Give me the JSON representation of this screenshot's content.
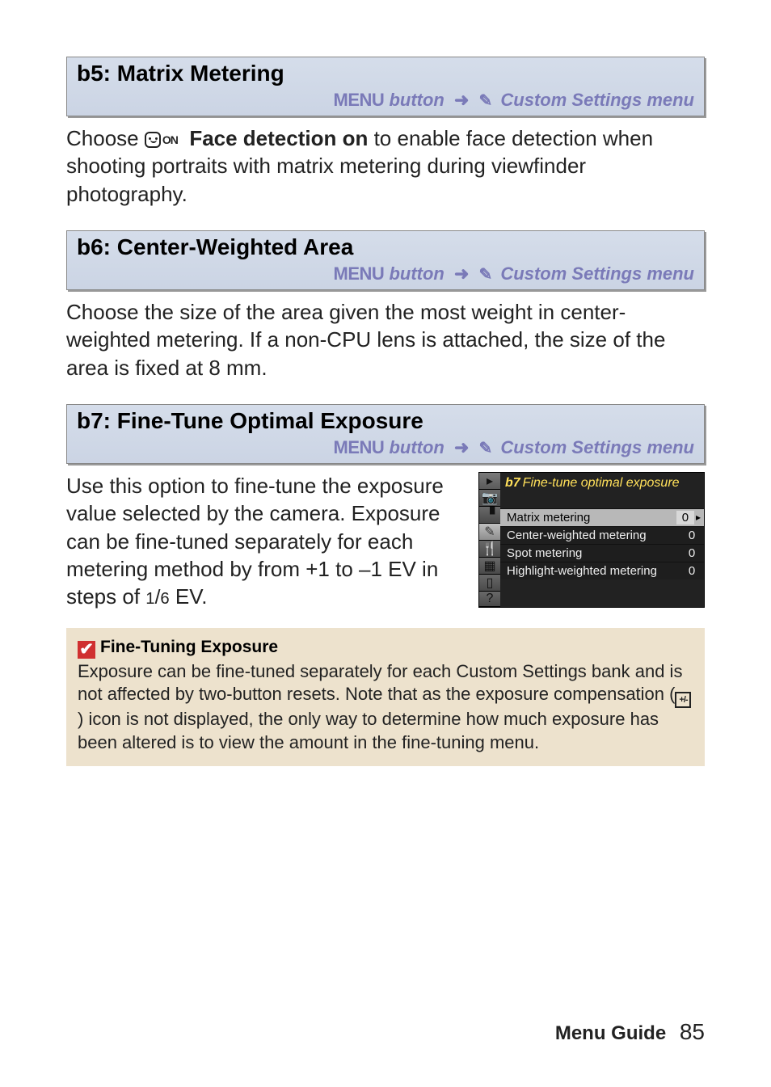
{
  "sections": {
    "b5": {
      "title": "b5: Matrix Metering",
      "path_menu": "MENU",
      "path_button": "button",
      "path_arrow": "➜",
      "path_target": "Custom Settings menu",
      "body_pre": "Choose ",
      "face_label": "ON",
      "body_bold": "Face detection on",
      "body_post": " to enable face detection when shooting portraits with matrix metering during viewfinder photography."
    },
    "b6": {
      "title": "b6: Center-Weighted Area",
      "path_menu": "MENU",
      "path_button": "button",
      "path_arrow": "➜",
      "path_target": "Custom Settings menu",
      "body": "Choose the size of the area given the most weight in center-weighted metering.  If a non-CPU lens is attached, the size of the area is fixed at 8 mm."
    },
    "b7": {
      "title": "b7: Fine-Tune Optimal Exposure",
      "path_menu": "MENU",
      "path_button": "button",
      "path_arrow": "➜",
      "path_target": "Custom Settings menu",
      "body_a": "Use this option to fine-tune the exposure value selected by the camera.  Exposure can be fine-tuned separately for each metering method by from +1 to –1 EV in steps of ",
      "frac_num": "1",
      "frac_slash": "/",
      "frac_den": "6",
      "body_b": " EV."
    }
  },
  "cam": {
    "title_prefix": "b7",
    "title_text": "Fine-tune optimal exposure",
    "items": [
      {
        "label": "Matrix metering",
        "val": "0",
        "sel": true
      },
      {
        "label": "Center-weighted metering",
        "val": "0",
        "sel": false
      },
      {
        "label": "Spot metering",
        "val": "0",
        "sel": false
      },
      {
        "label": "Highlight-weighted metering",
        "val": "0",
        "sel": false
      }
    ],
    "side_icons": [
      "▸",
      "📷",
      "▝",
      "✎",
      "🍴",
      "▦",
      "▯",
      "?"
    ],
    "sel_arrow": "▸"
  },
  "note": {
    "tick": "✔",
    "head": "Fine-Tuning Exposure",
    "body_a": "Exposure can be fine-tuned separately for each Custom Settings bank and is not affected by two-button resets.  Note that as the exposure compensation (",
    "icon_txt": "+/-",
    "body_b": ") icon is not displayed, the only way to determine how much exposure has been altered is to view the amount in the fine-tuning menu."
  },
  "footer": {
    "label": "Menu Guide",
    "page": "85"
  },
  "pen_glyph": "✎"
}
